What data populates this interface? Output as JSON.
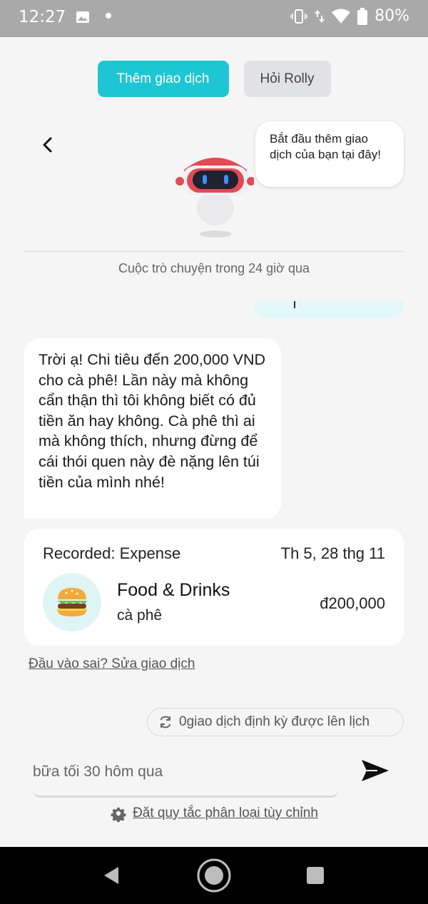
{
  "status_bar": {
    "time": "12:27",
    "battery_text": "80%",
    "icons": [
      "gallery-icon",
      "notification-dot",
      "vibrate-icon",
      "data-arrows-icon",
      "wifi-icon",
      "battery-icon"
    ]
  },
  "tabs": [
    {
      "label": "Thêm giao dịch",
      "active": true
    },
    {
      "label": "Hỏi Rolly",
      "active": false
    }
  ],
  "assistant_bubble": "Bắt đầu thêm giao dịch của bạn tại đây!",
  "history_label": "Cuộc trò chuyện trong 24 giờ qua",
  "assistant_message": "Trời ạ! Chi tiêu đến 200,000 VND cho cà phê! Lần này mà không cẩn thận thì tôi không biết có đủ tiền ăn hay không. Cà phê thì ai mà không thích, nhưng đừng để cái thói quen này đè nặng lên túi tiền của mình nhé!",
  "transaction_card": {
    "recorded_label": "Recorded: Expense",
    "date": "Th 5, 28 thg 11",
    "category": "Food & Drinks",
    "note": "cà phê",
    "amount": "đ200,000",
    "icon": "burger-icon"
  },
  "edit_link": "Đầu vào sai? Sửa giao dịch",
  "recurring_chip": "0giao dịch định kỳ được lên lịch",
  "input": {
    "placeholder": "bữa tối 30 hôm qua"
  },
  "custom_rules_link": "Đặt quy tắc phân loại tùy chỉnh",
  "colors": {
    "accent": "#1ec6d3",
    "background": "#f5f5f5",
    "status_bar": "#a9a9a9"
  }
}
